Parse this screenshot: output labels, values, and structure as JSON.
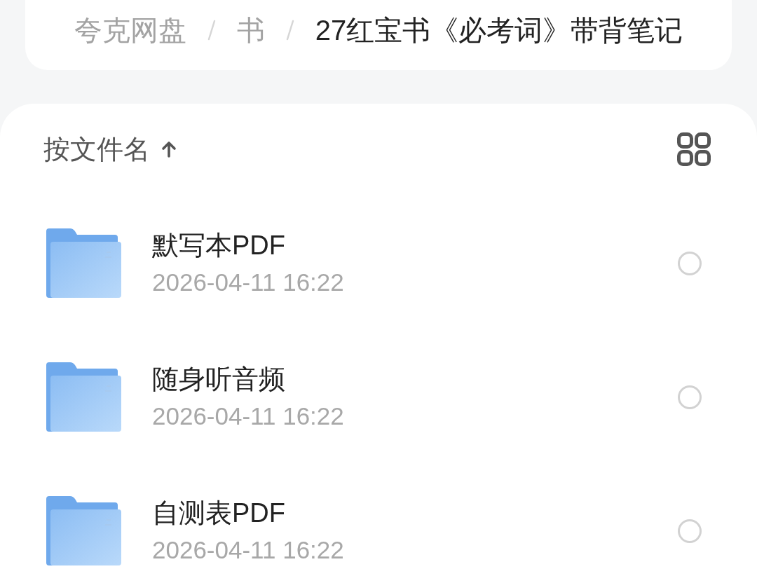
{
  "breadcrumb": [
    {
      "label": "夸克网盘",
      "current": false
    },
    {
      "label": "书",
      "current": false
    },
    {
      "label": "27红宝书《必考词》带背笔记",
      "current": true
    }
  ],
  "sort": {
    "label": "按文件名",
    "ascending": true
  },
  "files": [
    {
      "kind": "folder",
      "name": "默写本PDF",
      "date": "2026-04-11 16:22",
      "selected": false
    },
    {
      "kind": "folder",
      "name": "随身听音频",
      "date": "2026-04-11 16:22",
      "selected": false
    },
    {
      "kind": "folder",
      "name": "自测表PDF",
      "date": "2026-04-11 16:22",
      "selected": false
    }
  ]
}
